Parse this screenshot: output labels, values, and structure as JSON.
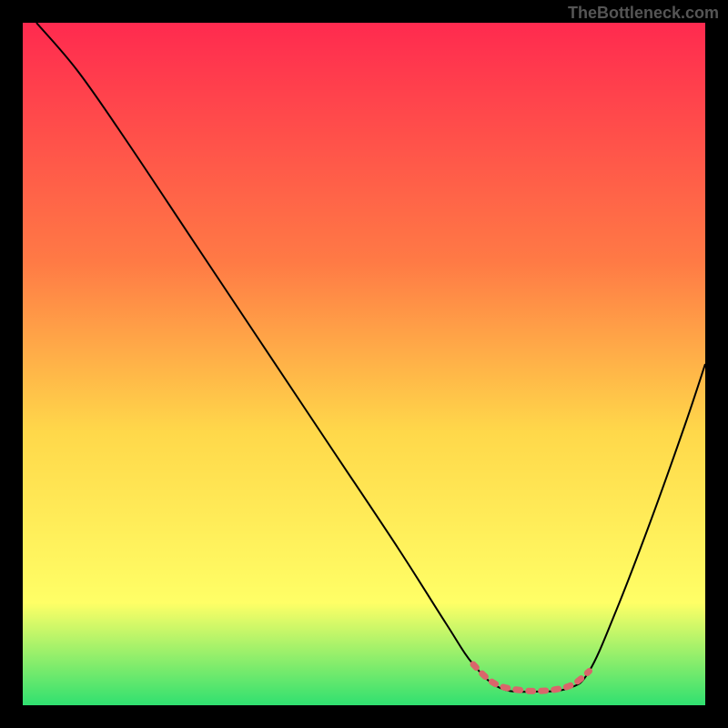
{
  "watermark": "TheBottleneck.com",
  "chart_data": {
    "type": "line",
    "title": "",
    "xlabel": "",
    "ylabel": "",
    "xlim": [
      0,
      100
    ],
    "ylim": [
      0,
      100
    ],
    "background_gradient": {
      "top": "#ff2a4f",
      "mid_upper": "#ff7a45",
      "mid": "#ffd84a",
      "mid_lower": "#ffff66",
      "bottom": "#30e070"
    },
    "series": [
      {
        "name": "main-curve",
        "color": "#000000",
        "stroke_width": 2,
        "points": [
          {
            "x": 2,
            "y": 100
          },
          {
            "x": 8,
            "y": 93
          },
          {
            "x": 15,
            "y": 83
          },
          {
            "x": 25,
            "y": 68
          },
          {
            "x": 35,
            "y": 53
          },
          {
            "x": 45,
            "y": 38
          },
          {
            "x": 55,
            "y": 23
          },
          {
            "x": 62,
            "y": 12
          },
          {
            "x": 66,
            "y": 6
          },
          {
            "x": 70,
            "y": 2.5
          },
          {
            "x": 75,
            "y": 2
          },
          {
            "x": 80,
            "y": 2.5
          },
          {
            "x": 83,
            "y": 5
          },
          {
            "x": 87,
            "y": 14
          },
          {
            "x": 92,
            "y": 27
          },
          {
            "x": 97,
            "y": 41
          },
          {
            "x": 100,
            "y": 50
          }
        ]
      },
      {
        "name": "highlight-segment",
        "color": "#d9666b",
        "stroke_width": 6,
        "points": [
          {
            "x": 66,
            "y": 6
          },
          {
            "x": 68,
            "y": 4
          },
          {
            "x": 70,
            "y": 2.8
          },
          {
            "x": 73,
            "y": 2.2
          },
          {
            "x": 76,
            "y": 2.1
          },
          {
            "x": 79,
            "y": 2.5
          },
          {
            "x": 81,
            "y": 3.3
          },
          {
            "x": 83,
            "y": 5
          }
        ]
      }
    ]
  }
}
